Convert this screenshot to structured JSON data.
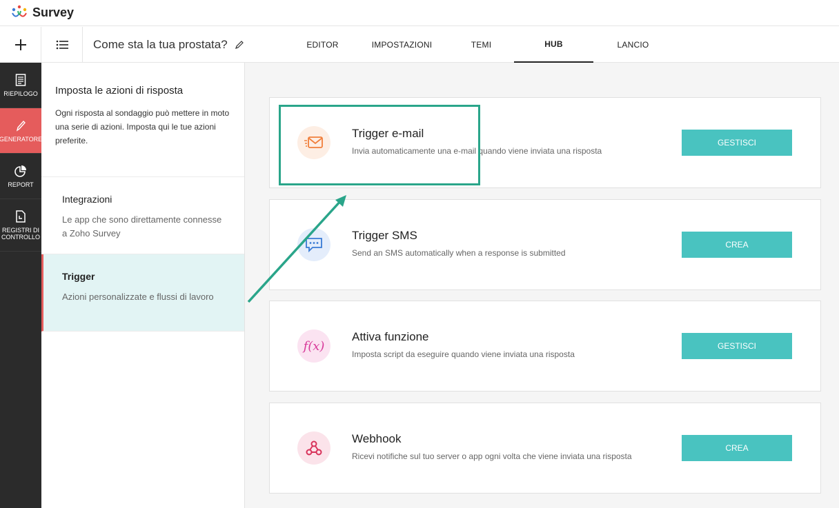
{
  "app": {
    "name": "Survey"
  },
  "header": {
    "survey_title": "Come sta la tua prostata?",
    "tabs": [
      {
        "label": "EDITOR"
      },
      {
        "label": "IMPOSTAZIONI"
      },
      {
        "label": "TEMI"
      },
      {
        "label": "HUB"
      },
      {
        "label": "LANCIO"
      }
    ],
    "active_tab": "HUB"
  },
  "leftnav": {
    "items": [
      {
        "label": "RIEPILOGO",
        "icon": "document-icon"
      },
      {
        "label": "GENERATORE",
        "icon": "pencil-icon"
      },
      {
        "label": "REPORT",
        "icon": "pie-chart-icon"
      },
      {
        "label": "REGISTRI DI CONTROLLO",
        "icon": "log-file-icon"
      }
    ],
    "active": "GENERATORE"
  },
  "panel": {
    "title": "Imposta le azioni di risposta",
    "description": "Ogni risposta al sondaggio può mettere in moto una serie di azioni. Imposta qui le tue azioni preferite.",
    "items": [
      {
        "title": "Integrazioni",
        "description": "Le app che sono direttamente connesse a Zoho Survey"
      },
      {
        "title": "Trigger",
        "description": "Azioni personalizzate e flussi di lavoro"
      }
    ],
    "active": "Trigger"
  },
  "cards": [
    {
      "title": "Trigger e-mail",
      "description": "Invia automaticamente una e-mail quando viene inviata una risposta",
      "button": "GESTISCI",
      "icon": "envelope-icon"
    },
    {
      "title": "Trigger SMS",
      "description": "Send an SMS automatically when a response is submitted",
      "button": "CREA",
      "icon": "sms-bubble-icon"
    },
    {
      "title": "Attiva funzione",
      "description": "Imposta script da eseguire quando viene inviata una risposta",
      "button": "GESTISCI",
      "icon": "function-icon",
      "icon_text": "f(x)"
    },
    {
      "title": "Webhook",
      "description": "Ricevi notifiche sul tuo server o app ogni volta che viene inviata una risposta",
      "button": "CREA",
      "icon": "webhook-icon"
    }
  ],
  "colors": {
    "accent": "#49c3c0",
    "nav_active": "#e55c5c",
    "nav_bg": "#2b2b2b",
    "highlight": "#2aa58a"
  }
}
